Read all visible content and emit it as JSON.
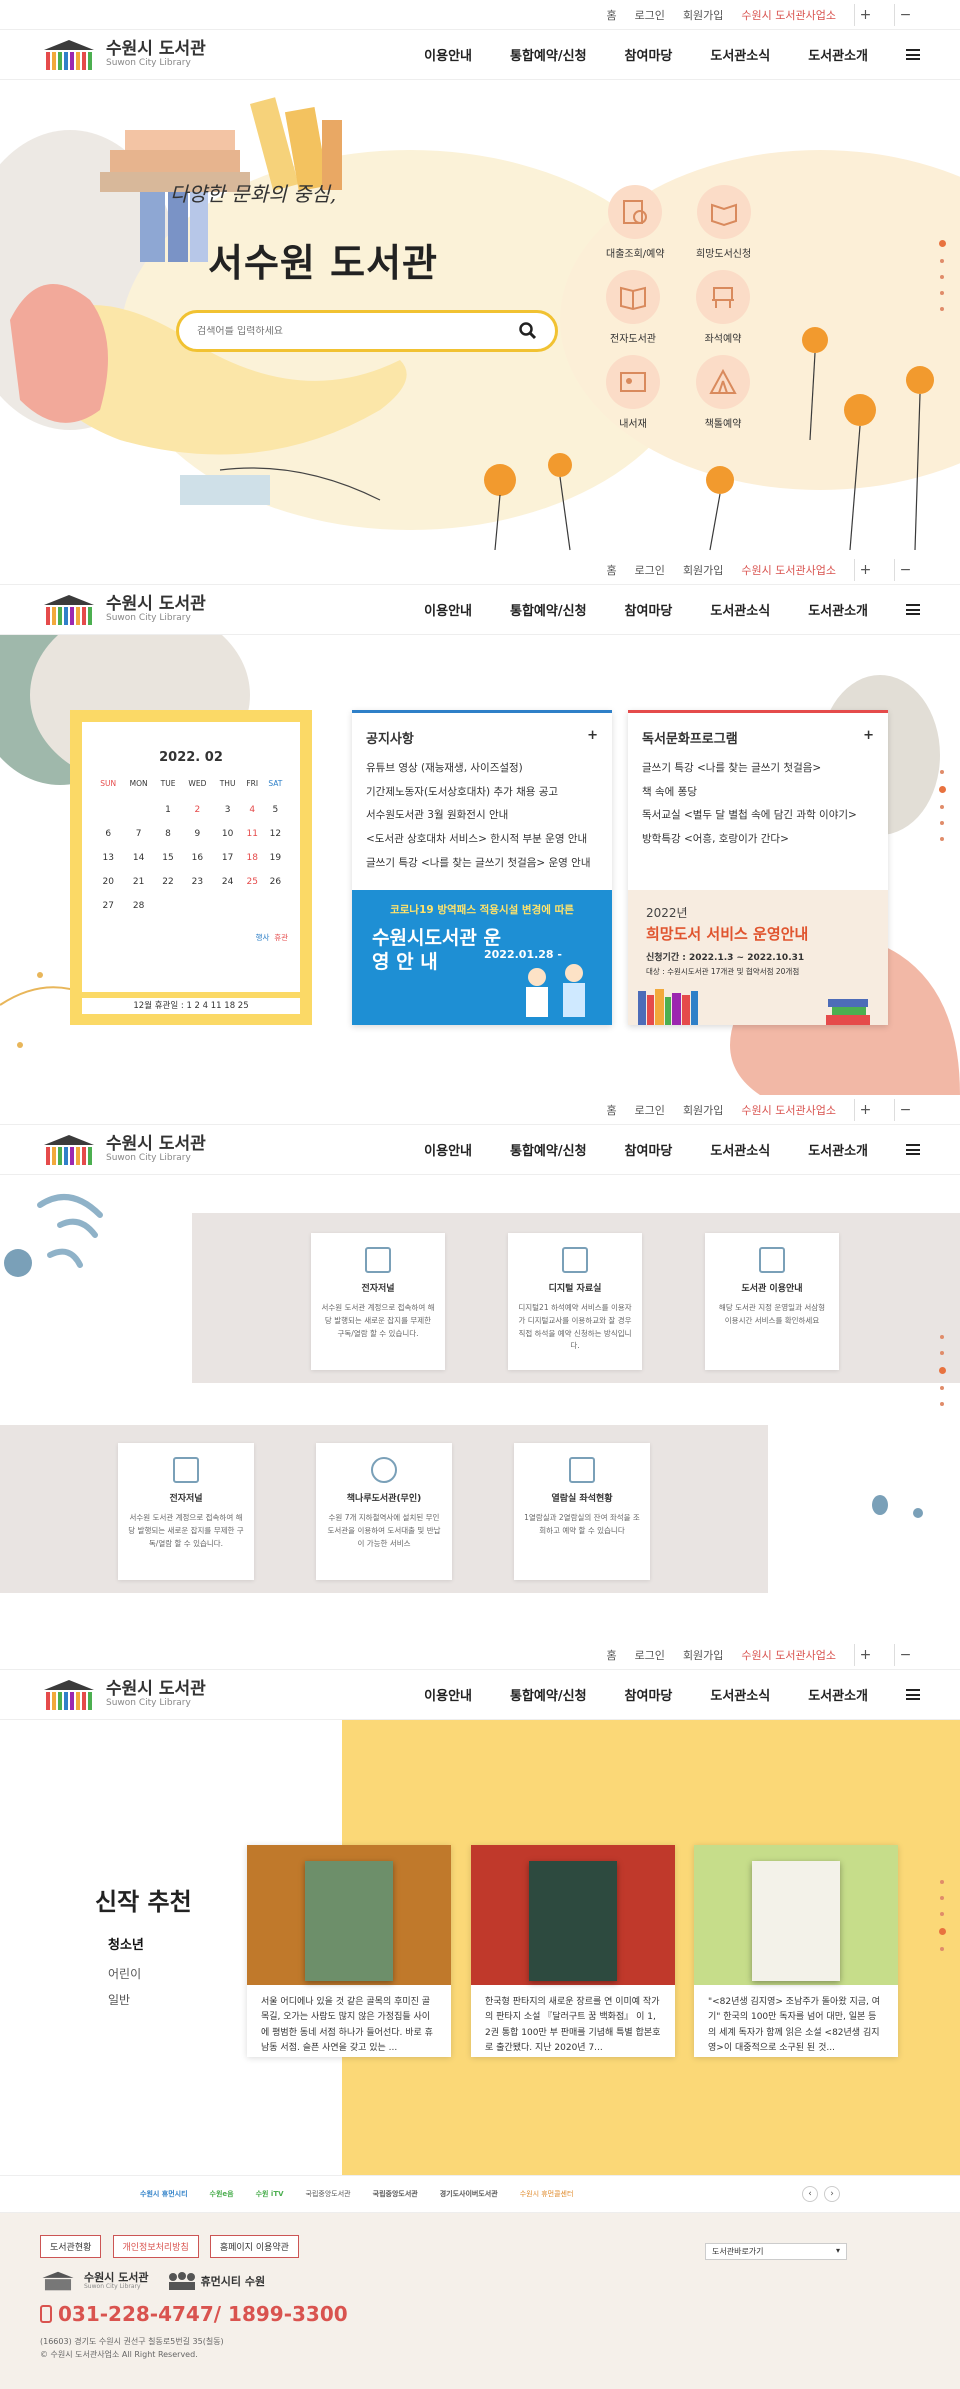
{
  "topbar": {
    "home": "홈",
    "login": "로그인",
    "join": "회원가입",
    "org": "수원시 도서관사업소",
    "plus": "+",
    "minus": "−"
  },
  "logo": {
    "ko": "수원시 도서관",
    "en": "Suwon City Library"
  },
  "nav": [
    "이용안내",
    "통합예약/신청",
    "참여마당",
    "도서관소식",
    "도서관소개"
  ],
  "hero": {
    "slogan": "다양한 문화의 중심,",
    "title": "서수원 도서관",
    "search_placeholder": "검색어를 입력하세요",
    "quick": [
      "대출조회/예약",
      "희망도서신청",
      "전자도서관",
      "좌석예약",
      "내서재",
      "책톨예약"
    ]
  },
  "calendar": {
    "month": "2022. 02",
    "days": [
      "SUN",
      "MON",
      "TUE",
      "WED",
      "THU",
      "FRI",
      "SAT"
    ],
    "rows": [
      [
        "",
        "",
        "1",
        "2",
        "3",
        "4",
        "5"
      ],
      [
        "6",
        "7",
        "8",
        "9",
        "10",
        "11",
        "12"
      ],
      [
        "13",
        "14",
        "15",
        "16",
        "17",
        "18",
        "19"
      ],
      [
        "20",
        "21",
        "22",
        "23",
        "24",
        "25",
        "26"
      ],
      [
        "27",
        "28",
        "",
        "",
        "",
        "",
        ""
      ]
    ],
    "legend": [
      "행사",
      "휴관"
    ],
    "closed": "12월 휴관일 :  1  2  4  11  18  25"
  },
  "notice": {
    "title": "공지사항",
    "plus": "+",
    "items": [
      "유튜브 영상 (재능재생, 사이즈설정)",
      "기간제노동자(도서상호대차) 추가 채용 공고",
      "서수원도서관 3월 원화전시 안내",
      "<도서관 상호대차 서비스> 한시적 부분 운영 안내",
      "글쓰기 특강 <나를 찾는 글쓰기 첫걸음> 운영 안내"
    ],
    "banner_top": "코로나19 방역패스 적용시설 변경에 따른",
    "banner_title": "수원시도서관 운 영 안 내",
    "banner_date": "2022.01.28 -"
  },
  "program": {
    "title": "독서문화프로그램",
    "plus": "+",
    "items": [
      "글쓰기 특강 <나를 찾는 글쓰기 첫걸음>",
      "책 속에 퐁당",
      "독서교실 <별두 달 별첩 속에 담긴 과학 이야기>",
      "방학특강 <어흥, 호랑이가 간다>"
    ],
    "banner_year": "2022년",
    "banner_title": "희망도서 서비스 운영안내",
    "banner_period": "신청기간 : 2022.1.3 ~ 2022.10.31",
    "banner_target": "대상 : 수원시도서관 17개관 및 협약서점 20개점"
  },
  "cards1": [
    {
      "title": "전자저널",
      "desc": "서수원 도서관 계정으로 접속하여 해당 발행되는 새로운 잡지를 무제한 구독/열람 할 수 있습니다."
    },
    {
      "title": "디지털 자료실",
      "desc": "디지털21 하석예약 서비스를 이용자가 디지털교사를 이용하교와 잘 경우 직접 하석을 예약 신청하는 방식입니다."
    },
    {
      "title": "도서관 이용안내",
      "desc": "해당 도서관 지정 운영일과 서삼형 이용시간 서비스를 확인하세요"
    }
  ],
  "cards2": [
    {
      "title": "전자저널",
      "desc": "서수원 도서관 계정으로 접속하여 해당 발행되는 새로운 잡지를 무제한 구독/열람 할 수 있습니다."
    },
    {
      "title": "책나루도서관(무인)",
      "desc": "수원 7개 지하철역사에 설치된 무인도서관을 이용하여 도서대출 및 반납이 가능한 서비스"
    },
    {
      "title": "열람실 좌석현황",
      "desc": "1열람실과 2열람실의 잔여 좌석을 조회하고 예약 할 수 있습니다"
    }
  ],
  "recommend": {
    "title": "신작 추천",
    "tabs": [
      "청소년",
      "어린이",
      "일반"
    ],
    "books": [
      {
        "desc": "서울 어디에나 있을 것 같은 골목의 후미진 골목길, 오가는 사람도 많지 않은 가정집들 사이에 평범한 동네 서점 하나가 들어선다. 바로 휴남동 서점. 슬픈 사연을 갖고 있는 ..."
      },
      {
        "desc": "한국형 판타지의 새로운 장르를 연 이미예 작가의 판타지 소설 『달러구트 꿈 백화점』 이 1, 2권 통합 100만 부 판매를 기념해 특별 합본호로 출간됐다. 지난 2020년 7..."
      },
      {
        "desc": "\"<82년생 김지영> 조남주가 돌아왔 지금, 여기\" 한국의 100만 독자를 넘어 대만, 일본 등의 세계 독자가 함께 읽은 소설 <82년생 김지영>이 대중적으로 소구된 된 것..."
      }
    ]
  },
  "partners": [
    "수원시 휴먼시티",
    "수원e음",
    "수원 iTV",
    "국립중앙도서관",
    "국립중앙도서관",
    "경기도사이버도서관",
    "수원시 휴먼콜센터"
  ],
  "footer": {
    "buttons": [
      "도서관현황",
      "개인정보처리방침",
      "홈페이지 이용약관"
    ],
    "select": "도서관바로가기",
    "phone": "031-228-4747/ 1899-3300",
    "address": "(16603) 경기도 수원시 권선구 칠동로5번길 35(칠동)",
    "copy": "© 수원시 도서관사업소 All Right Reserved.",
    "logo2": "휴먼시티 수원"
  }
}
